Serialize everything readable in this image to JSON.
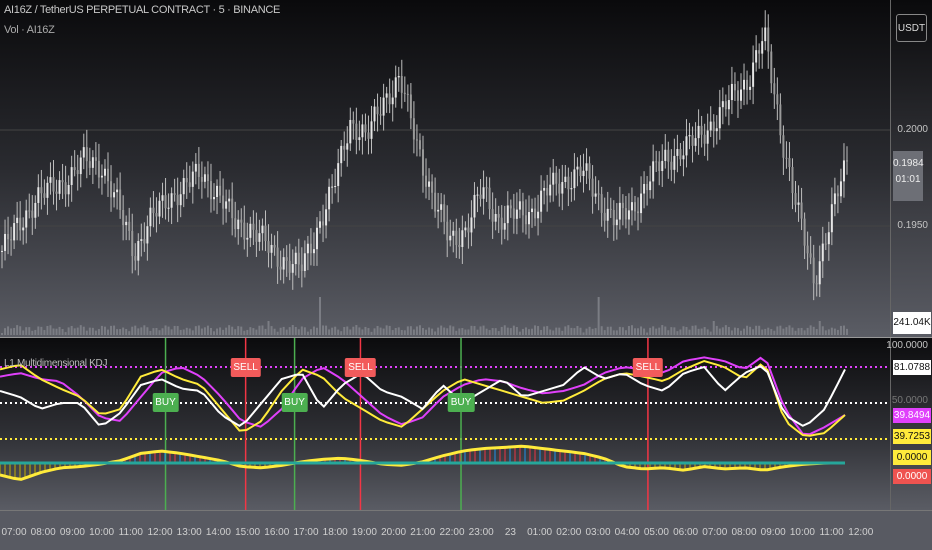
{
  "header": {
    "symbol_title": "AI16Z / TetherUS PERPETUAL CONTRACT · 5 · BINANCE",
    "volume_label": "Vol · AI16Z",
    "currency_button": "USDT"
  },
  "price_axis": {
    "ticks": [
      {
        "label": "0.2000",
        "value": 0.2
      },
      {
        "label": "0.1950",
        "value": 0.195
      }
    ],
    "current_price": "0.1984",
    "countdown": "01:01",
    "volume_value": "241.04K"
  },
  "price_series": {
    "closes": [
      0.1937,
      0.195,
      0.1964,
      0.1969,
      0.1975,
      0.1984,
      0.1982,
      0.196,
      0.1937,
      0.1953,
      0.1965,
      0.1969,
      0.1979,
      0.1966,
      0.1953,
      0.1948,
      0.194,
      0.1932,
      0.1927,
      0.1948,
      0.1969,
      0.2005,
      0.1995,
      0.2016,
      0.2026,
      0.1995,
      0.1964,
      0.1943,
      0.1948,
      0.1969,
      0.1953,
      0.1956,
      0.1958,
      0.1969,
      0.1974,
      0.1979,
      0.1964,
      0.1953,
      0.1958,
      0.1974,
      0.1984,
      0.199,
      0.1995,
      0.2005,
      0.2016,
      0.2026,
      0.2049,
      0.2,
      0.1958,
      0.1922,
      0.1953,
      0.1984
    ],
    "min": 0.1905,
    "max": 0.2055
  },
  "indicator": {
    "title": "L1 Multidimensional KDJ",
    "levels": {
      "upper": 80,
      "mid": 50,
      "lower": 20
    },
    "axis": {
      "top": "100.0000",
      "labels": [
        {
          "text": "81.0788",
          "bg": "#ffffff",
          "fg": "#111"
        },
        {
          "text": "39.8494",
          "bg": "#e040fb",
          "fg": "#fff"
        },
        {
          "text": "39.7253",
          "bg": "#ffeb3b",
          "fg": "#111"
        },
        {
          "text": "0.0000",
          "bg": "#ffeb3b",
          "fg": "#111"
        },
        {
          "text": "0.0000",
          "bg": "#ef5350",
          "fg": "#fff"
        }
      ],
      "mid_hidden": "50.0000"
    },
    "series": {
      "white": [
        60,
        55,
        45,
        50,
        50,
        30,
        42,
        65,
        70,
        62,
        60,
        40,
        30,
        50,
        70,
        75,
        45,
        65,
        75,
        60,
        55,
        45,
        65,
        50,
        60,
        70,
        55,
        60,
        65,
        80,
        70,
        75,
        65,
        60,
        75,
        80,
        60,
        75,
        82,
        40,
        30,
        45,
        78
      ],
      "yellow": [
        78,
        82,
        70,
        62,
        55,
        40,
        45,
        72,
        78,
        70,
        65,
        45,
        25,
        35,
        60,
        78,
        72,
        55,
        45,
        35,
        30,
        45,
        60,
        70,
        65,
        60,
        55,
        50,
        52,
        60,
        70,
        75,
        72,
        68,
        78,
        85,
        80,
        70,
        85,
        35,
        22,
        25,
        40
      ],
      "magenta": [
        72,
        75,
        70,
        68,
        55,
        38,
        35,
        55,
        75,
        80,
        72,
        55,
        35,
        30,
        45,
        70,
        80,
        70,
        55,
        40,
        32,
        38,
        55,
        65,
        70,
        68,
        62,
        58,
        60,
        65,
        75,
        80,
        78,
        75,
        85,
        88,
        85,
        78,
        90,
        45,
        22,
        30,
        40
      ],
      "momentum": [
        -10,
        -14,
        -8,
        -4,
        -3,
        -1,
        2,
        8,
        10,
        8,
        5,
        2,
        -3,
        -4,
        -2,
        1,
        3,
        4,
        2,
        -1,
        -2,
        1,
        6,
        10,
        12,
        13,
        14,
        12,
        10,
        8,
        4,
        -3,
        -5,
        -4,
        -6,
        -3,
        -5,
        -4,
        -6,
        -3,
        -1,
        0,
        0
      ]
    },
    "signals": [
      {
        "type": "BUY",
        "label": "BUY",
        "pos": 0.186
      },
      {
        "type": "SELL",
        "label": "SELL",
        "pos": 0.276
      },
      {
        "type": "BUY",
        "label": "BUY",
        "pos": 0.331
      },
      {
        "type": "SELL",
        "label": "SELL",
        "pos": 0.405
      },
      {
        "type": "BUY",
        "label": "BUY",
        "pos": 0.518
      },
      {
        "type": "SELL",
        "label": "SELL",
        "pos": 0.728
      }
    ],
    "colors": {
      "buy": "#4caf50",
      "sell": "#f23645",
      "white": "#ffffff",
      "yellow": "#ffeb3b",
      "magenta": "#e040fb",
      "blue": "#2196f3"
    }
  },
  "time_axis": [
    "07:00",
    "08:00",
    "09:00",
    "10:00",
    "11:00",
    "12:00",
    "13:00",
    "14:00",
    "15:00",
    "16:00",
    "17:00",
    "18:00",
    "19:00",
    "20:00",
    "21:00",
    "22:00",
    "23:00",
    "23",
    "01:00",
    "02:00",
    "03:00",
    "04:00",
    "05:00",
    "06:00",
    "07:00",
    "08:00",
    "09:00",
    "10:00",
    "11:00",
    "12:00"
  ]
}
